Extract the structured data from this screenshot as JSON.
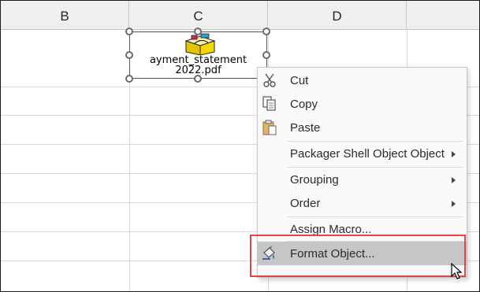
{
  "columns": [
    "B",
    "C",
    "D",
    ""
  ],
  "object": {
    "label_line1": "ayment_statement",
    "label_line2": "2022.pdf",
    "icon": "packager-icon"
  },
  "context_menu": {
    "items": [
      {
        "label": "Cut",
        "icon": "scissors-icon"
      },
      {
        "label": "Copy",
        "icon": "copy-icon"
      },
      {
        "label": "Paste",
        "icon": "paste-icon"
      },
      {
        "label": "Packager Shell Object Object",
        "submenu": true
      },
      {
        "label": "Grouping",
        "submenu": true
      },
      {
        "label": "Order",
        "submenu": true
      },
      {
        "label": "Assign Macro..."
      },
      {
        "label": "Format Object...",
        "icon": "format-object-icon",
        "highlighted": true
      }
    ]
  },
  "colors": {
    "highlight_border": "#e04848",
    "hover_bg": "#c6c6c6"
  }
}
